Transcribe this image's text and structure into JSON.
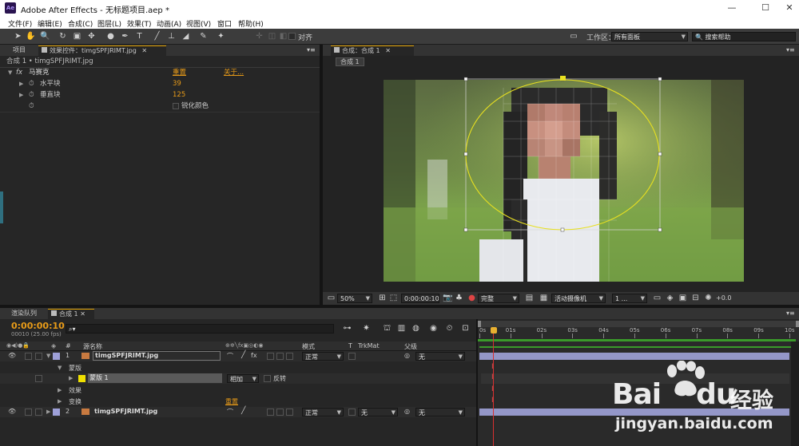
{
  "window": {
    "app_icon": "Ae",
    "title": "Adobe After Effects - 无标题项目.aep *",
    "minimize": "—",
    "maximize": "☐",
    "close": "✕"
  },
  "menu": [
    "文件(F)",
    "编辑(E)",
    "合成(C)",
    "图层(L)",
    "效果(T)",
    "动画(A)",
    "视图(V)",
    "窗口",
    "帮助(H)"
  ],
  "toolbar": {
    "align_label": "对齐",
    "workspace_label": "工作区：",
    "workspace_value": "所有面板",
    "search_placeholder": "搜索帮助"
  },
  "effects_panel": {
    "tab_project": "项目",
    "tab_effect_controls": "效果控件：timgSPFJRIMT.jpg",
    "breadcrumb": "合成 1 • timgSPFJRIMT.jpg",
    "fx_icon": "fx",
    "effect_name": "马赛克",
    "reset": "重置",
    "about": "关于...",
    "horizontal_label": "水平块",
    "horizontal_value": "39",
    "vertical_label": "垂直块",
    "vertical_value": "125",
    "sharpen_label": "锐化颜色"
  },
  "comp_panel": {
    "tab_label": "合成：合成 1",
    "breadcrumb": "合成 1",
    "zoom": "50%",
    "timecode": "0:00:00:10",
    "resolution": "完整",
    "camera": "活动摄像机",
    "views": "1 ...",
    "exposure": "+0.0"
  },
  "timeline": {
    "tab_render_queue": "渲染队列",
    "tab_comp": "合成 1",
    "current_time": "0:00:00:10",
    "frame_info": "00010 (25.00 fps)",
    "search_placeholder": "",
    "col_num": "#",
    "col_source": "源名称",
    "col_mode": "模式",
    "col_t": "T",
    "col_trkmat": "TrkMat",
    "col_parent": "父级",
    "ruler": [
      "0s",
      "01s",
      "02s",
      "03s",
      "04s",
      "05s",
      "06s",
      "07s",
      "08s",
      "09s",
      "10s"
    ],
    "layers": [
      {
        "num": "1",
        "name": "timgSPFJRIMT.jpg",
        "mode": "正常",
        "trkmat": "",
        "parent": "无"
      },
      {
        "num": "2",
        "name": "timgSPFJRIMT.jpg",
        "mode": "正常",
        "trkmat": "无",
        "parent": "无"
      }
    ],
    "mask_group": "蒙版",
    "mask_name": "蒙版 1",
    "mask_mode": "相加",
    "mask_invert": "反转",
    "effects_group": "效果",
    "transform_group": "变换",
    "transform_reset": "重置"
  },
  "watermark": {
    "brand_a": "Bai",
    "brand_b": "du",
    "brand_cn": "经验",
    "url": "jingyan.baidu.com"
  },
  "colors": {
    "accent": "#e89b18",
    "mask_path": "#e8e020",
    "layer_bar": "#9497c8",
    "layer_label_1": "#9ea0d8",
    "mask_label": "#f0e000",
    "playhead": "#d83030",
    "work_area": "#3a9a2a"
  }
}
